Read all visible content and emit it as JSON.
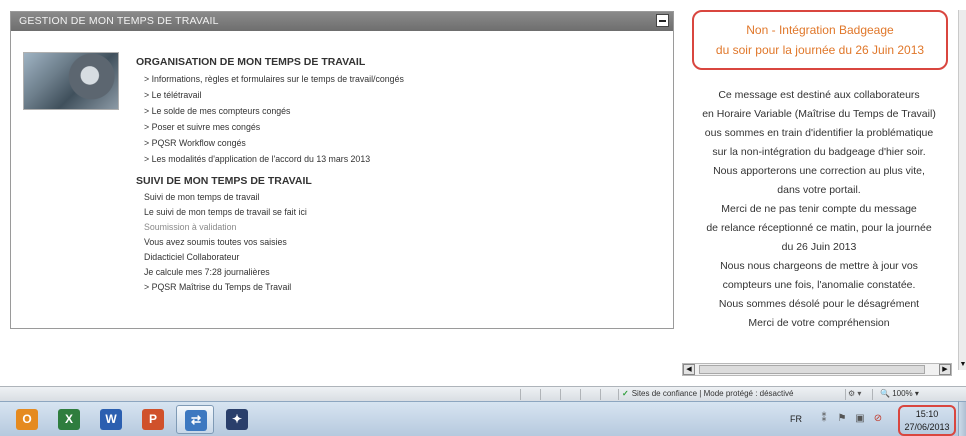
{
  "portlet": {
    "title": "GESTION DE MON TEMPS DE TRAVAIL",
    "section1": {
      "title": "ORGANISATION DE MON TEMPS DE TRAVAIL",
      "links": [
        "> Informations, règles et formulaires sur le temps de travail/congés",
        "> Le télétravail",
        "> Le solde de mes compteurs congés",
        "> Poser et suivre mes congés",
        "> PQSR Workflow congés",
        "> Les modalités d'application de l'accord du 13 mars 2013"
      ]
    },
    "section2": {
      "title": "SUIVI DE MON TEMPS DE TRAVAIL",
      "items": [
        "Suivi de mon temps de travail",
        "Le suivi de mon temps de travail se fait ici",
        "Soumission à validation",
        "Vous avez soumis toutes vos saisies",
        "Didacticiel Collaborateur",
        "Je calcule mes 7:28 journalières",
        "> PQSR Maîtrise du Temps de Travail"
      ]
    }
  },
  "message": {
    "alert_line1": "Non - Intégration Badgeage",
    "alert_line2": "du soir pour la journée du 26 Juin 2013",
    "lines": [
      "Ce message est destiné aux collaborateurs",
      "en Horaire Variable (Maîtrise du Temps de Travail)",
      "ous sommes en train d'identifier la problématique",
      "sur la non-intégration du badgeage d'hier soir.",
      "Nous apporterons une correction au plus vite,",
      "dans votre portail.",
      "Merci de ne pas tenir compte du message",
      "de relance réceptionné ce matin, pour la journée",
      "du 26 Juin 2013",
      "Nous nous chargeons de mettre à jour vos",
      "compteurs une fois, l'anomalie constatée.",
      "Nous sommes désolé pour le désagrément",
      "Merci de votre compréhension"
    ]
  },
  "statusbar": {
    "zone_text": "Sites de confiance | Mode protégé : désactivé",
    "zoom": "100%"
  },
  "taskbar": {
    "apps": [
      {
        "icon": "outlook-icon",
        "glyph": "O",
        "color": "#e58a1f"
      },
      {
        "icon": "excel-icon",
        "glyph": "X",
        "color": "#2f7d3e"
      },
      {
        "icon": "word-icon",
        "glyph": "W",
        "color": "#2b5fb0"
      },
      {
        "icon": "powerpoint-icon",
        "glyph": "P",
        "color": "#d0512b"
      },
      {
        "icon": "switch-windows-icon",
        "glyph": "⇄",
        "color": "#3d78c0"
      },
      {
        "icon": "app-icon",
        "glyph": "✦",
        "color": "#2a3f6b"
      }
    ],
    "language": "FR",
    "time": "15:10",
    "date": "27/06/2013"
  }
}
